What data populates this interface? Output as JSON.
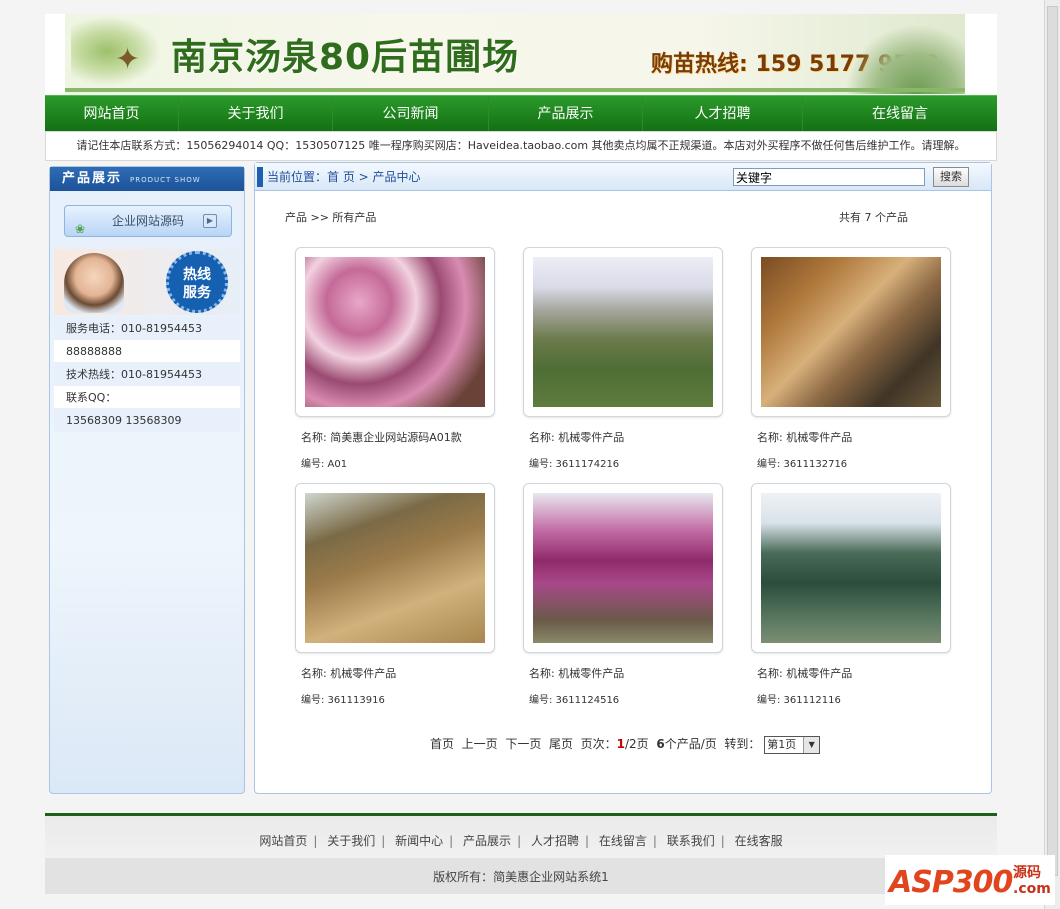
{
  "banner": {
    "title": "南京汤泉80后苗圃场",
    "hotline": "购苗热线: 159 5177 9513"
  },
  "nav": {
    "items": [
      "网站首页",
      "关于我们",
      "公司新闻",
      "产品展示",
      "人才招聘",
      "在线留言"
    ]
  },
  "notice": "请记住本店联系方式：15056294014 QQ：1530507125 唯一程序购买网店：Haveidea.taobao.com 其他卖点均属不正规渠道。本店对外买程序不做任何售后维护工作。请理解。",
  "sidebar": {
    "title": "产品展示",
    "title_en": "PRODUCT SHOW",
    "button_label": "企业网站源码",
    "badge": [
      "热线",
      "服务"
    ],
    "contacts": [
      "服务电话：010-81954453",
      "88888888",
      "技术热线：010-81954453",
      "联系QQ：",
      "13568309    13568309"
    ]
  },
  "main": {
    "location": "当前位置：首 页 > 产品中心",
    "search_value": "关键字",
    "search_button": "搜索",
    "crumb": "产品 >> 所有产品",
    "total": "共有 7 个产品"
  },
  "products": [
    {
      "name": "名称: 简美惠企业网站源码A01款",
      "code": "编号: A01"
    },
    {
      "name": "名称: 机械零件产品",
      "code": "编号: 3611174216"
    },
    {
      "name": "名称: 机械零件产品",
      "code": "编号: 3611132716"
    },
    {
      "name": "名称: 机械零件产品",
      "code": "编号: 361113916"
    },
    {
      "name": "名称: 机械零件产品",
      "code": "编号: 3611124516"
    },
    {
      "name": "名称: 机械零件产品",
      "code": "编号: 361112116"
    }
  ],
  "pager": {
    "first": "首页",
    "prev": "上一页",
    "next": "下一页",
    "last": "尾页",
    "page_label": "页次：",
    "current": "1",
    "of_total": "/2页",
    "per_page_count": "6",
    "per_page_label": "个产品/页",
    "goto_label": "转到：",
    "select_value": "第1页"
  },
  "footer": {
    "links": [
      "网站首页",
      "关于我们",
      "新闻中心",
      "产品展示",
      "人才招聘",
      "在线留言",
      "联系我们",
      "在线客服"
    ],
    "copyright": "版权所有：简美惠企业网站系统1"
  },
  "watermark": {
    "brand": "ASP300",
    "tag1": "源码",
    "tag2": ".com"
  }
}
